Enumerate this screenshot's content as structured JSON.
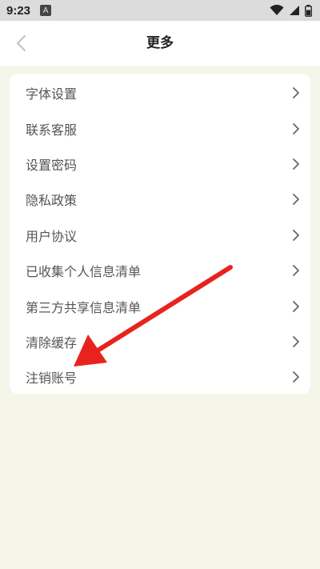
{
  "status_bar": {
    "time": "9:23",
    "notification_badge": "A"
  },
  "header": {
    "title": "更多"
  },
  "menu": {
    "items": [
      {
        "label": "字体设置"
      },
      {
        "label": "联系客服"
      },
      {
        "label": "设置密码"
      },
      {
        "label": "隐私政策"
      },
      {
        "label": "用户协议"
      },
      {
        "label": "已收集个人信息清单"
      },
      {
        "label": "第三方共享信息清单"
      },
      {
        "label": "清除缓存"
      },
      {
        "label": "注销账号"
      }
    ]
  },
  "colors": {
    "page_background": "#f5f6e9",
    "card_background": "#ffffff",
    "annotation_arrow": "#e8231e"
  },
  "icons": {
    "back": "chevron-left-icon",
    "item_arrow": "chevron-right-icon",
    "wifi": "wifi-icon",
    "signal": "signal-icon",
    "battery": "battery-icon"
  }
}
